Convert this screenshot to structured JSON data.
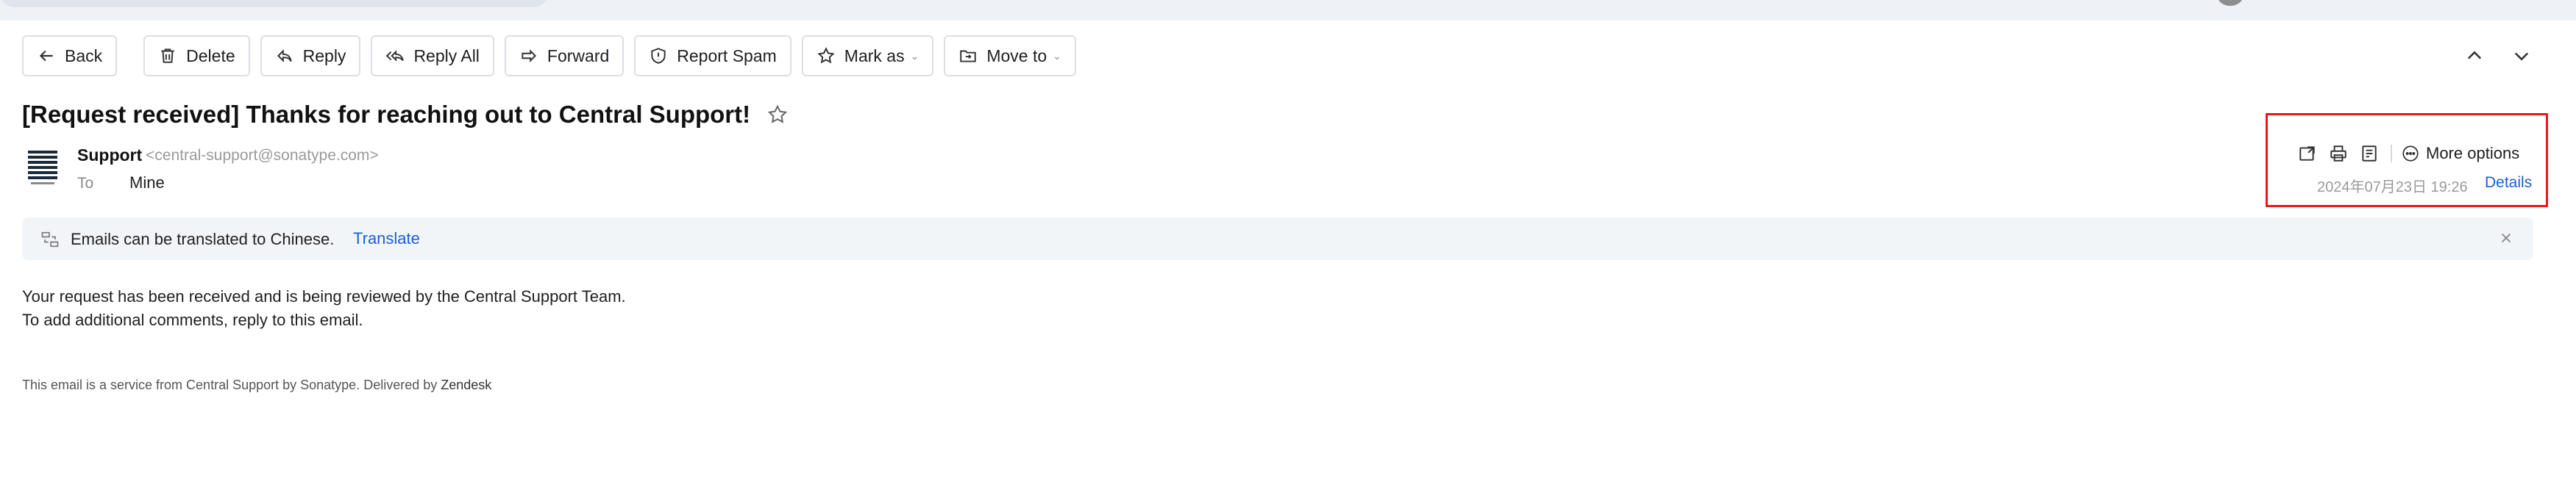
{
  "toolbar": {
    "back": "Back",
    "delete": "Delete",
    "reply": "Reply",
    "reply_all": "Reply All",
    "forward": "Forward",
    "report_spam": "Report Spam",
    "mark_as": "Mark as",
    "move_to": "Move to"
  },
  "email": {
    "subject": "[Request received] Thanks for reaching out to Central Support!",
    "sender_name": "Support",
    "sender_email": "<central-support@sonatype.com>",
    "to_label": "To",
    "to_value": "Mine",
    "more_options": "More options",
    "date": "2024年07月23日 19:26",
    "details": "Details"
  },
  "banner": {
    "message": "Emails can be translated to Chinese.",
    "translate": "Translate"
  },
  "body": {
    "line1": "Your request has been received and is being reviewed by the Central Support Team.",
    "line2": "To add additional comments, reply to this email.",
    "footer": "This email is a service from Central Support by Sonatype. Delivered by ",
    "footer_link": "Zendesk"
  },
  "icons": {
    "back": "arrow-left-icon",
    "delete": "trash-icon",
    "reply": "reply-icon",
    "reply_all": "reply-all-icon",
    "forward": "forward-icon",
    "report_spam": "shield-icon",
    "mark_as": "star-icon",
    "move_to": "folder-icon",
    "prev": "chevron-up-icon",
    "next": "chevron-down-icon",
    "star": "star-outline-icon",
    "open_window": "open-new-window-icon",
    "print": "printer-icon",
    "note": "note-icon",
    "more": "more-circle-icon",
    "translate": "translate-icon",
    "close": "close-icon"
  },
  "colors": {
    "accent": "#1a5fd6",
    "highlight": "#e8191d",
    "banner_bg": "#f2f5f8"
  }
}
